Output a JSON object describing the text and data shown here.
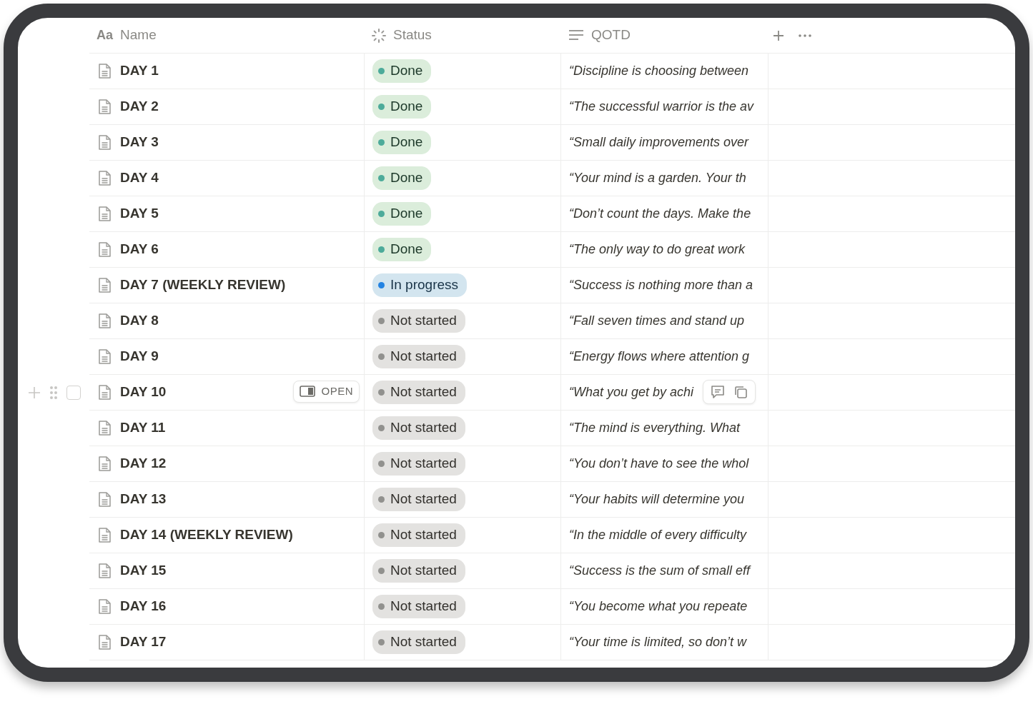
{
  "columns": [
    {
      "kind": "title",
      "icon_text": "Aa",
      "label": "Name"
    },
    {
      "kind": "status",
      "label": "Status"
    },
    {
      "kind": "text",
      "label": "QOTD"
    }
  ],
  "header_actions": [
    {
      "kind": "add"
    },
    {
      "kind": "more"
    }
  ],
  "rows": [
    {
      "name": "DAY 1",
      "status": {
        "kind": "done",
        "label": "Done",
        "color": "#4dab9a"
      },
      "quote": "“Discipline is choosing between",
      "hovered": false
    },
    {
      "name": "DAY 2",
      "status": {
        "kind": "done",
        "label": "Done",
        "color": "#4dab9a"
      },
      "quote": "“The successful warrior is the av",
      "hovered": false
    },
    {
      "name": "DAY 3",
      "status": {
        "kind": "done",
        "label": "Done",
        "color": "#4dab9a"
      },
      "quote": "“Small daily improvements over",
      "hovered": false
    },
    {
      "name": "DAY 4",
      "status": {
        "kind": "done",
        "label": "Done",
        "color": "#4dab9a"
      },
      "quote": "“Your mind is a garden. Your th",
      "hovered": false
    },
    {
      "name": "DAY 5",
      "status": {
        "kind": "done",
        "label": "Done",
        "color": "#4dab9a"
      },
      "quote": "“Don’t count the days. Make the",
      "hovered": false
    },
    {
      "name": "DAY 6",
      "status": {
        "kind": "done",
        "label": "Done",
        "color": "#4dab9a"
      },
      "quote": "“The only way to do great work",
      "hovered": false
    },
    {
      "name": "DAY 7 (WEEKLY REVIEW)",
      "status": {
        "kind": "in_progress",
        "label": "In progress",
        "color": "#2383e2"
      },
      "quote": "“Success is nothing more than a",
      "hovered": false
    },
    {
      "name": "DAY 8",
      "status": {
        "kind": "not_started",
        "label": "Not started",
        "color": "#91918e"
      },
      "quote": "“Fall seven times and stand up",
      "hovered": false
    },
    {
      "name": "DAY 9",
      "status": {
        "kind": "not_started",
        "label": "Not started",
        "color": "#91918e"
      },
      "quote": "“Energy flows where attention g",
      "hovered": false
    },
    {
      "name": "DAY 10",
      "status": {
        "kind": "not_started",
        "label": "Not started",
        "color": "#91918e"
      },
      "quote": "“What you get by achi",
      "hovered": true,
      "checked": false,
      "open_label": "OPEN"
    },
    {
      "name": "DAY 11",
      "status": {
        "kind": "not_started",
        "label": "Not started",
        "color": "#91918e"
      },
      "quote": "“The mind is everything. What",
      "hovered": false
    },
    {
      "name": "DAY 12",
      "status": {
        "kind": "not_started",
        "label": "Not started",
        "color": "#91918e"
      },
      "quote": "“You don’t have to see the whol",
      "hovered": false
    },
    {
      "name": "DAY 13",
      "status": {
        "kind": "not_started",
        "label": "Not started",
        "color": "#91918e"
      },
      "quote": "“Your habits will determine you",
      "hovered": false
    },
    {
      "name": "DAY 14 (WEEKLY REVIEW)",
      "status": {
        "kind": "not_started",
        "label": "Not started",
        "color": "#91918e"
      },
      "quote": "“In the middle of every difficulty",
      "hovered": false
    },
    {
      "name": "DAY 15",
      "status": {
        "kind": "not_started",
        "label": "Not started",
        "color": "#91918e"
      },
      "quote": "“Success is the sum of small eff",
      "hovered": false
    },
    {
      "name": "DAY 16",
      "status": {
        "kind": "not_started",
        "label": "Not started",
        "color": "#91918e"
      },
      "quote": "“You become what you repeate",
      "hovered": false
    },
    {
      "name": "DAY 17",
      "status": {
        "kind": "not_started",
        "label": "Not started",
        "color": "#91918e"
      },
      "quote": "“Your time is limited, so don’t w",
      "hovered": false
    }
  ]
}
